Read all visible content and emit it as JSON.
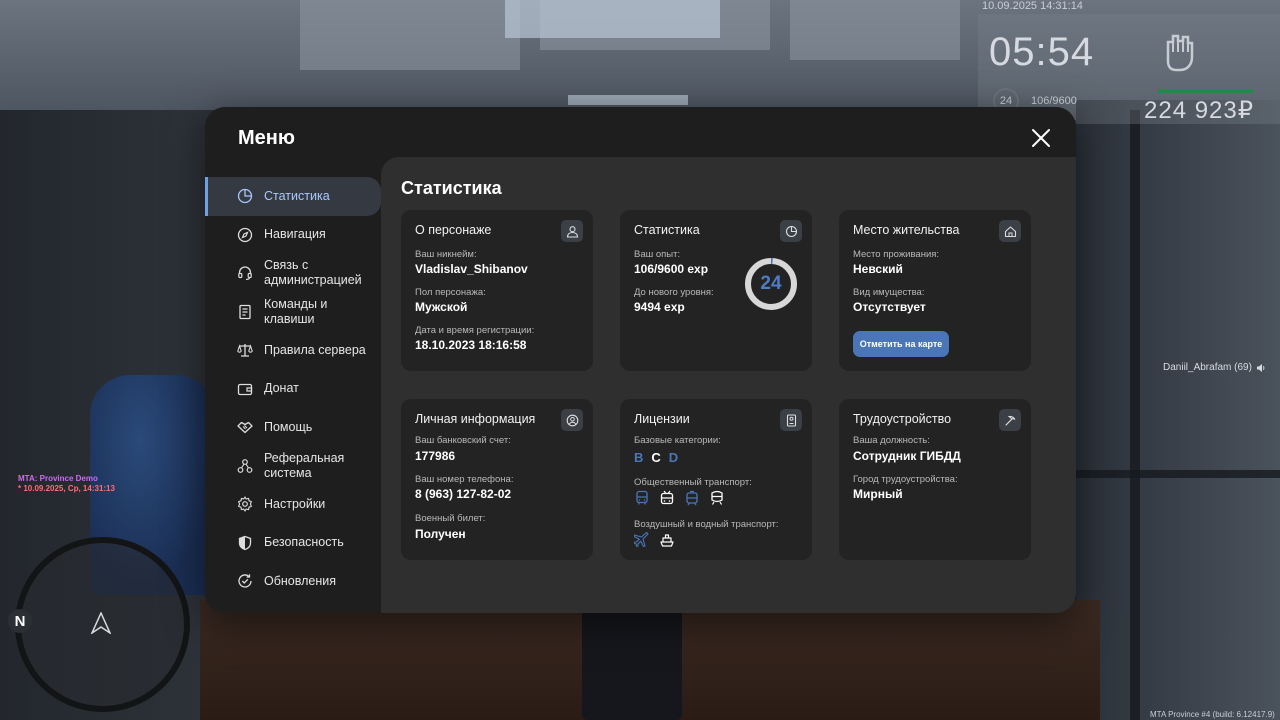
{
  "hud": {
    "datetime": "10.09.2025 14:31:14",
    "time": "05:54",
    "level": "24",
    "exp": "106/9600",
    "money": "224 923₽"
  },
  "server": {
    "name": "MTA: Province Demo",
    "datetime": "* 10.09.2025, Ср, 14:31:13",
    "build": "MTA Province #4 (build: 6.12417.9)"
  },
  "player_tag": "Daniil_Abrafam (69)",
  "minimap": {
    "north_label": "N"
  },
  "menu": {
    "title": "Меню",
    "nav": [
      {
        "label": "Статистика",
        "icon": "chart-pie-icon",
        "active": true
      },
      {
        "label": "Навигация",
        "icon": "compass-icon"
      },
      {
        "label": "Связь с администрацией",
        "icon": "headset-icon"
      },
      {
        "label": "Команды и клавиши",
        "icon": "document-icon"
      },
      {
        "label": "Правила сервера",
        "icon": "scales-icon"
      },
      {
        "label": "Донат",
        "icon": "wallet-icon"
      },
      {
        "label": "Помощь",
        "icon": "handshake-icon"
      },
      {
        "label": "Реферальная система",
        "icon": "network-icon"
      },
      {
        "label": "Настройки",
        "icon": "gear-icon"
      },
      {
        "label": "Безопасность",
        "icon": "shield-icon"
      },
      {
        "label": "Обновления",
        "icon": "refresh-check-icon"
      }
    ]
  },
  "content": {
    "title": "Статистика",
    "character": {
      "title": "О персонаже",
      "nick_label": "Ваш никнейм:",
      "nick": "Vladislav_Shibanov",
      "gender_label": "Пол персонажа:",
      "gender": "Мужской",
      "reg_label": "Дата и время регистрации:",
      "reg": "18.10.2023 18:16:58"
    },
    "stats": {
      "title": "Статистика",
      "exp_label": "Ваш опыт:",
      "exp": "106/9600 exp",
      "next_label": "До нового уровня:",
      "next": "9494 exp",
      "level": "24",
      "level_progress": 0.011
    },
    "residence": {
      "title": "Место жительства",
      "place_label": "Место проживания:",
      "place": "Невский",
      "property_label": "Вид имущества:",
      "property": "Отсутствует",
      "map_button": "Отметить на карте"
    },
    "personal": {
      "title": "Личная информация",
      "bank_label": "Ваш банковский счет:",
      "bank": "177986",
      "phone_label": "Ваш номер телефона:",
      "phone": "8 (963) 127-82-02",
      "military_label": "Военный билет:",
      "military": "Получен"
    },
    "licenses": {
      "title": "Лицензии",
      "base_label": "Базовые категории:",
      "categories": [
        "B",
        "C",
        "D"
      ],
      "public_label": "Общественный транспорт:",
      "air_label": "Воздушный и водный транспорт:"
    },
    "job": {
      "title": "Трудоустройство",
      "position_label": "Ваша должность:",
      "position": "Сотрудник ГИБДД",
      "city_label": "Город трудоустройства:",
      "city": "Мирный"
    }
  },
  "colors": {
    "accent": "#4a76b8",
    "nav_active_text": "#a9c7ff",
    "card_bg": "#232323",
    "content_bg": "#2f2f2f",
    "menu_bg": "#1e1e1e"
  }
}
